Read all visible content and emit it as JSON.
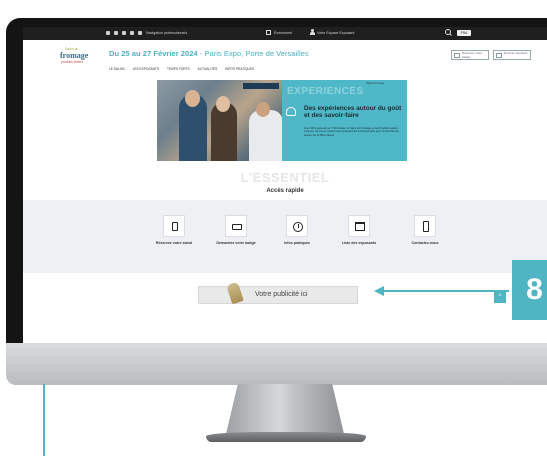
{
  "topbar": {
    "nav_pro": "Navigation professionnels",
    "events": "Évènement",
    "espace": "Votre Espace Exposant",
    "lang": "FRA"
  },
  "header": {
    "logo_top": "Salon du",
    "logo_main": "fromage",
    "logo_sub": "produits laitiers",
    "dates": "Du 25 au 27 Février 2024",
    "place": " - Paris Expo, Porte de Versailles",
    "btn_stand": "Réservez votre badge",
    "btn_exposant": "Devenir exposant"
  },
  "menu": [
    "LE SALON",
    "LES EXPOSANTS",
    "TEMPS FORTS",
    "ACTUALITÉS",
    "INFOS PRATIQUES"
  ],
  "hero": {
    "watermark": "EXPERIENCES",
    "social_note": "#SalonFromage",
    "title": "Des expériences autour du goût et des savoir-faire",
    "text": "Avec 220 exposants et 7 500 visites, le Salon du Fromage et des Produits Laitiers s'impose comme le rendez-vous professionnel incontournable pour l'ensemble des acteurs de la filière laitière."
  },
  "essentiel": {
    "ghost": "L'ESSENTIEL",
    "title": "Accès rapide"
  },
  "quick": [
    {
      "label": "Réservez votre stand"
    },
    {
      "label": "Demandez votre badge"
    },
    {
      "label": "Infos pratiques"
    },
    {
      "label": "Liste des exposants"
    },
    {
      "label": "Contactez-nous"
    }
  ],
  "ad": {
    "text": "Votre publicité ici"
  },
  "scroll_top": "^",
  "callout": {
    "number": "8"
  },
  "colors": {
    "accent": "#4fb5c2",
    "hero_panel": "#4fb8c8",
    "quick_bg": "#eef0f3"
  }
}
